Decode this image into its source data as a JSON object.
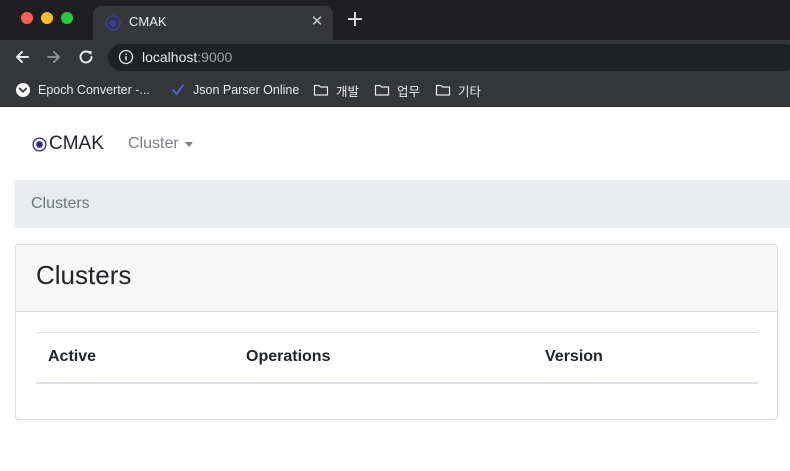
{
  "browser": {
    "tab": {
      "title": "CMAK",
      "favicon": "cmak-logo-icon"
    },
    "new_tab_label": "+",
    "close_label": "✕",
    "address": {
      "host": "localhost",
      "port": ":9000"
    },
    "bookmarks": [
      {
        "label": "Epoch Converter -...",
        "icon": "chevron-circle-icon"
      },
      {
        "label": "Json Parser Online",
        "icon": "checkmark-icon"
      },
      {
        "label": "개발",
        "icon": "folder-icon"
      },
      {
        "label": "업무",
        "icon": "folder-icon"
      },
      {
        "label": "기타",
        "icon": "folder-icon"
      }
    ]
  },
  "app": {
    "brand": "CMAK",
    "nav": {
      "cluster_label": "Cluster"
    },
    "breadcrumb": {
      "current": "Clusters"
    },
    "card": {
      "title": "Clusters",
      "table": {
        "columns": [
          "Active",
          "Operations",
          "Version"
        ],
        "rows": []
      }
    }
  },
  "colors": {
    "brand_logo": "#2d2c8a",
    "breadcrumb_bg": "#e9ecef",
    "card_header_bg": "#f7f7f7"
  }
}
